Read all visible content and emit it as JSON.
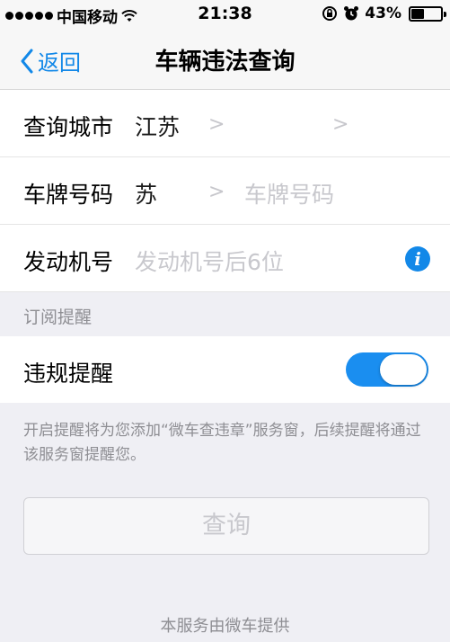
{
  "status_bar": {
    "carrier": "中国移动",
    "time": "21:38",
    "battery_text": "43%",
    "battery_level": 0.43
  },
  "nav": {
    "back_label": "返回",
    "title": "车辆违法查询"
  },
  "form": {
    "city_label": "查询城市",
    "city_value": "江苏",
    "city_chevron_1": ">",
    "city_chevron_2": ">",
    "plate_label": "车牌号码",
    "plate_prefix": "苏",
    "plate_chevron": ">",
    "plate_placeholder": "车牌号码",
    "engine_label": "发动机号",
    "engine_placeholder": "发动机号后6位",
    "info_icon": "i"
  },
  "subscribe": {
    "section_title": "订阅提醒",
    "toggle_label": "违规提醒",
    "toggle_on": true,
    "note": "开启提醒将为您添加“微车查违章”服务窗，后续提醒将通过该服务窗提醒您。"
  },
  "actions": {
    "query_label": "查询"
  },
  "footer": {
    "text": "本服务由微车提供"
  },
  "colors": {
    "accent": "#1288e8",
    "toggle_on": "#1a8ef0",
    "placeholder": "#c8c8cd",
    "background": "#efeff4"
  }
}
